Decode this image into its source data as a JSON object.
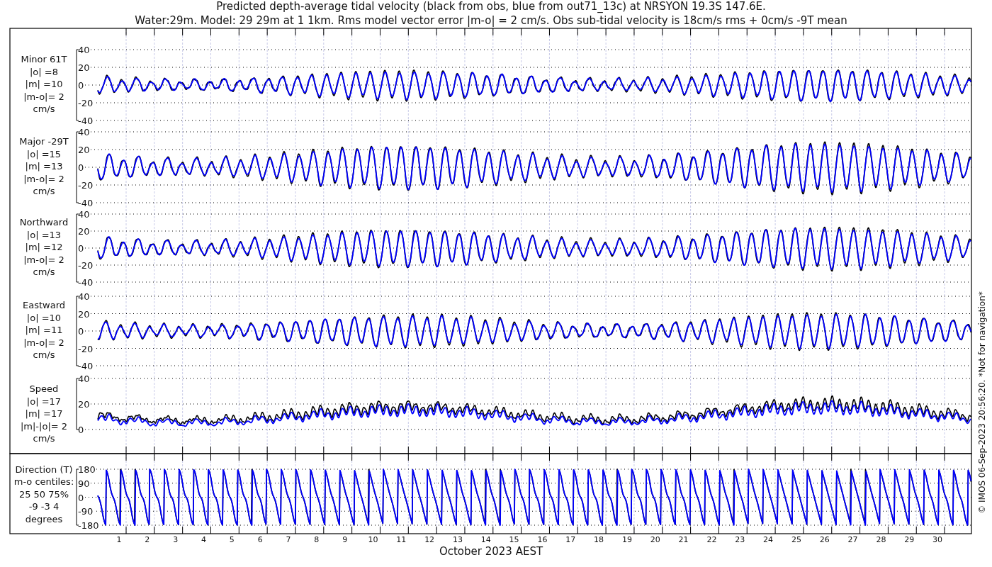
{
  "title": [
    "Predicted depth-average tidal velocity (black from obs, blue from out71_13c) at NRSYON 19.3S 147.6E.",
    "Water:29m. Model: 29 29m at 1 1km. Rms model vector error |m-o| = 2 cm/s. Obs sub-tidal velocity is 18cm/s rms + 0cm/s -9T mean"
  ],
  "series": [
    {
      "color": "#000000"
    },
    {
      "color": "#0000ff"
    }
  ],
  "panels": [
    {
      "kind": "velocity",
      "label": [
        "Minor 61T",
        "|o| =8",
        "|m| =10",
        "|m-o|= 2",
        "cm/s"
      ],
      "yticks": [
        "40",
        "20",
        "0",
        "-20",
        "-40"
      ]
    },
    {
      "kind": "velocity",
      "label": [
        "Major -29T",
        "|o| =15",
        "|m| =13",
        "|m-o|= 2",
        "cm/s"
      ],
      "yticks": [
        "40",
        "20",
        "0",
        "-20",
        "-40"
      ]
    },
    {
      "kind": "velocity",
      "label": [
        "Northward",
        "|o| =13",
        "|m| =12",
        "|m-o|= 2",
        "cm/s"
      ],
      "yticks": [
        "40",
        "20",
        "0",
        "-20",
        "-40"
      ]
    },
    {
      "kind": "velocity",
      "label": [
        "Eastward",
        "|o| =10",
        "|m| =11",
        "|m-o|= 2",
        "cm/s"
      ],
      "yticks": [
        "40",
        "20",
        "0",
        "-20",
        "-40"
      ]
    },
    {
      "kind": "speed",
      "label": [
        "Speed",
        "|o| =17",
        "|m| =17",
        "|m|-|o|= 2",
        "cm/s"
      ],
      "yticks": [
        "40",
        "20",
        "0"
      ]
    },
    {
      "kind": "direction",
      "label": [
        "Direction (T)",
        "m-o centiles:",
        "25  50  75%",
        "-9 -3  4",
        "degrees"
      ],
      "yticks": [
        "180",
        "90",
        "0",
        "-90",
        "-180"
      ]
    }
  ],
  "xaxis": {
    "ticks": [
      "1",
      "2",
      "3",
      "4",
      "5",
      "6",
      "7",
      "8",
      "9",
      "10",
      "11",
      "12",
      "13",
      "14",
      "15",
      "16",
      "17",
      "18",
      "19",
      "20",
      "21",
      "22",
      "23",
      "24",
      "25",
      "26",
      "27",
      "28",
      "29",
      "30"
    ],
    "label": "October 2023 AEST"
  },
  "credit": "© IMOS 06-Sep-2023 20:56:20. *Not for navigation*"
}
